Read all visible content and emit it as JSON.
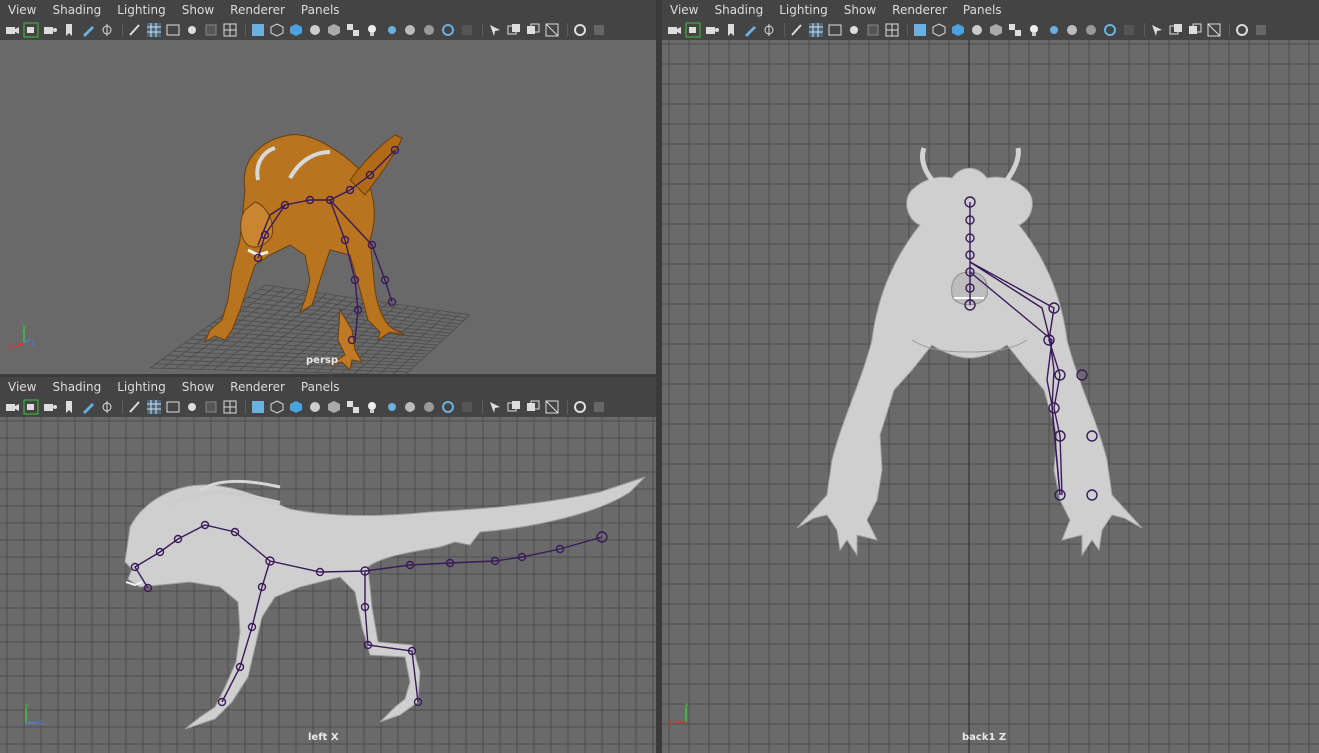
{
  "panels": {
    "persp": {
      "menu": [
        "View",
        "Shading",
        "Lighting",
        "Show",
        "Renderer",
        "Panels"
      ],
      "camera_label": "persp"
    },
    "left": {
      "menu": [
        "View",
        "Shading",
        "Lighting",
        "Show",
        "Renderer",
        "Panels"
      ],
      "camera_label": "left X"
    },
    "back": {
      "menu": [
        "View",
        "Shading",
        "Lighting",
        "Show",
        "Renderer",
        "Panels"
      ],
      "camera_label": "back1 Z"
    }
  },
  "toolbar_icons": [
    "camera-icon",
    "camera-select-icon",
    "camera-lock-icon",
    "bookmark-icon",
    "pencil-icon",
    "grease-pencil-icon",
    "brush-icon",
    "grid-icon",
    "film-gate-icon",
    "resolution-gate-icon",
    "field-chart-icon",
    "safe-action-icon",
    "safe-title-icon",
    "wireframe-icon",
    "smooth-shade-icon",
    "default-material-icon",
    "textured-icon",
    "checker-icon",
    "lights-icon",
    "shadows-icon",
    "ambient-occlusion-icon",
    "motion-blur-icon",
    "antialias-icon",
    "depth-of-field-icon",
    "isolate-select-icon",
    "xray-icon",
    "xray-joints-icon",
    "xray-active-icon",
    "backface-icon",
    "exposure-icon"
  ],
  "axis_labels": {
    "x": "x",
    "y": "y",
    "z": "z"
  },
  "colors": {
    "viewport_bg": "#6a6a6a",
    "panel_bg": "#444444",
    "grid_line": "#4a4a4a",
    "grid_axis": "#2f2f2f",
    "joint_color": "#3a1a5a",
    "model_gray": "#cfcfcf",
    "model_orange": "#b8741e",
    "active_icon": "#4aa3df"
  }
}
